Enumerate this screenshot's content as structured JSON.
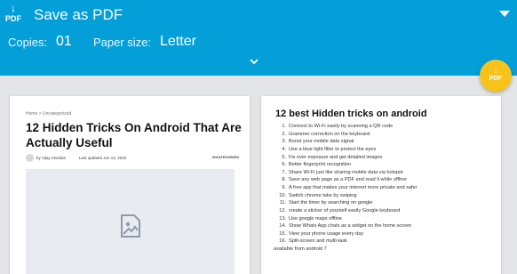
{
  "header": {
    "logo_text": "PDF",
    "title": "Save as PDF",
    "copies_label": "Copies:",
    "copies_value": "01",
    "paper_label": "Paper size:",
    "paper_value": "Letter"
  },
  "fab": {
    "text": "PDF"
  },
  "page1": {
    "breadcrumb": "Home  >  Uncategorized",
    "title": "12 Hidden Tricks On Android That Are Actually Useful",
    "author": "by Vijay Sivedas",
    "updated": "Last updated Jun 13, 2022",
    "category": "UNCATEGORIZED"
  },
  "page2": {
    "title": "12 best Hidden tricks on android",
    "items": [
      {
        "n": "1.",
        "text": "Connect to Wi-Fi easily by scanning a QR code"
      },
      {
        "n": "2.",
        "text": "Grammer correction on the keyboard"
      },
      {
        "n": "3.",
        "text": "Boost your mobile data signal"
      },
      {
        "n": "4.",
        "text": "Use a blue light filter to protect the eyes"
      },
      {
        "n": "5.",
        "text": "Fix over exposure and get detailed images"
      },
      {
        "n": "6.",
        "text": "Better fingerprint recognition"
      },
      {
        "n": "7.",
        "text": "Share Wi-Fi just like sharing mobile data via hotspot"
      },
      {
        "n": "8.",
        "text": "Save any web page as a PDF and read it while offline"
      },
      {
        "n": "9.",
        "text": "A free app that makes your internet more private and safer"
      },
      {
        "n": "10.",
        "text": "Switch chrome tabs by swiping"
      },
      {
        "n": "11.",
        "text": "Start the timer by searching on google"
      },
      {
        "n": "12.",
        "text": "create a sticker of yourself easily Google keyboard"
      },
      {
        "n": "13.",
        "text": "Use google maps offline"
      },
      {
        "n": "14.",
        "text": "Show Whats App chats as a widget on the home screen"
      },
      {
        "n": "15.",
        "text": "View your phone usage every day"
      },
      {
        "n": "16.",
        "text": "Split-screen and multi-task"
      }
    ],
    "continuation": "available from android 7"
  },
  "colors": {
    "header": "#049fd9",
    "fab": "#f7c31b"
  },
  "icons": {
    "logo": "download-arrow-icon",
    "expand": "chevron-down-icon",
    "dropdown": "caret-down-icon",
    "image": "image-placeholder-icon"
  }
}
